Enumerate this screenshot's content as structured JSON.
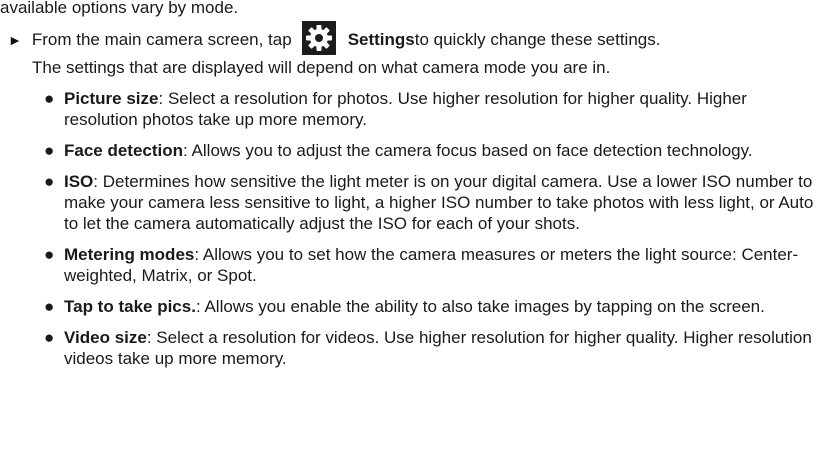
{
  "intro_fragment": "available options vary by mode.",
  "step": {
    "marker": "►",
    "text_before_icon": "From the main camera screen, tap",
    "icon": "gear-icon",
    "icon_bg": "#1c1c1c",
    "bold_label": "Settings",
    "text_after_icon": " to quickly change these settings.",
    "continuation": "The settings that are displayed will depend on what camera mode you are in."
  },
  "bullets": [
    {
      "term": "Picture size",
      "desc": ": Select a resolution for photos. Use higher resolution for higher quality. Higher resolution photos take up more memory."
    },
    {
      "term": "Face detection",
      "desc": ": Allows you to adjust the camera focus based on face detection technology."
    },
    {
      "term": "ISO",
      "desc": ": Determines how sensitive the light meter is on your digital camera. Use a lower ISO number to make your camera less sensitive to light, a higher ISO number to take photos with less light, or Auto to let the camera automatically adjust the ISO for each of your shots."
    },
    {
      "term": "Metering modes",
      "desc": ": Allows you to set how the camera measures or meters the light source: Center-weighted, Matrix, or Spot."
    },
    {
      "term": "Tap to take pics.",
      "desc": ": Allows you enable the ability to also take images by tapping on the screen."
    },
    {
      "term": "Video size",
      "desc": ": Select a resolution for videos. Use higher resolution for higher quality. Higher resolution videos take up more memory."
    }
  ]
}
